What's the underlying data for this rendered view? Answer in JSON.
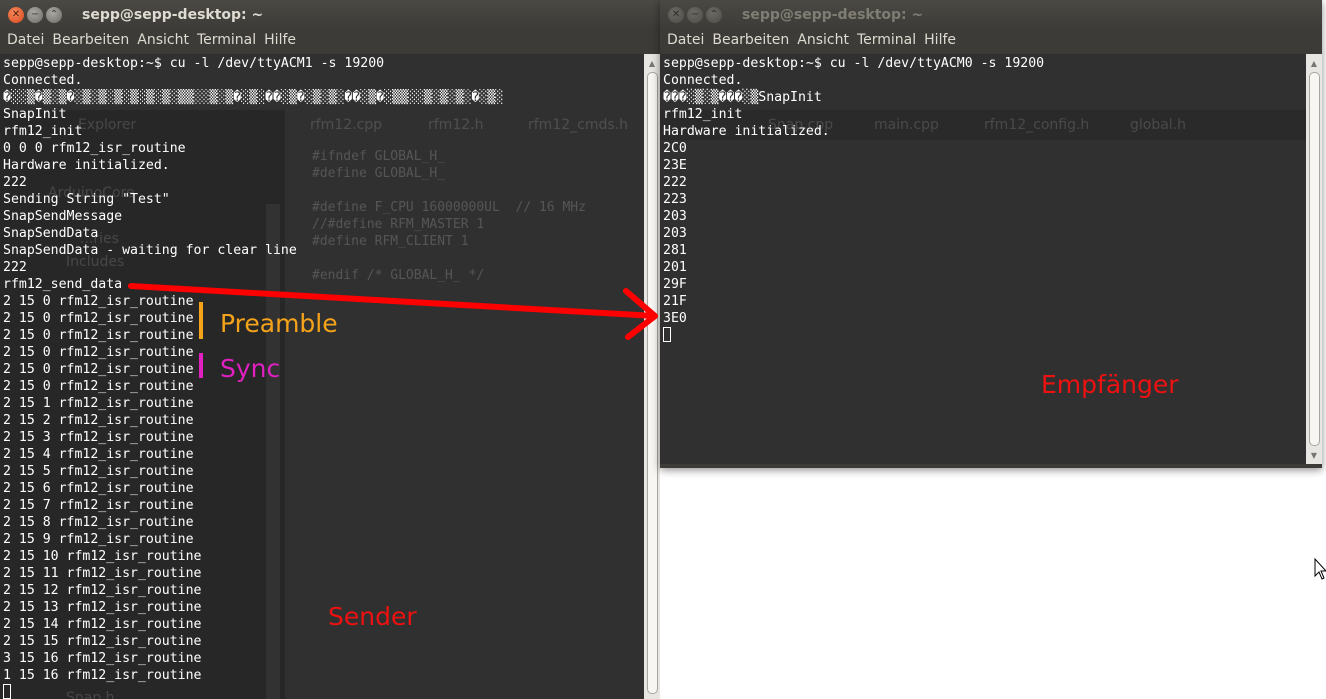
{
  "left_window": {
    "title": "sepp@sepp-desktop: ~",
    "menu": [
      "Datei",
      "Bearbeiten",
      "Ansicht",
      "Terminal",
      "Hilfe"
    ],
    "lines": [
      "sepp@sepp-desktop:~$ cu -l /dev/ttyACM1 -s 19200",
      "Connected.",
      "�░░▒�▒░▒�░▒░▒░▒░▒░▒░▒░▒▒░░▒░▒�░▒░��░▒�░▒░▒░��░▒�░▒▒░░▒░▒░▒░�░▒░",
      "SnapInit",
      "rfm12_init",
      "0 0 0 rfm12_isr_routine",
      "Hardware initialized.",
      "222",
      "Sending String \"Test\"",
      "SnapSendMessage",
      "SnapSendData",
      "SnapSendData - waiting for clear line",
      "222",
      "rfm12_send_data",
      "2 15 0 rfm12_isr_routine",
      "2 15 0 rfm12_isr_routine",
      "2 15 0 rfm12_isr_routine",
      "2 15 0 rfm12_isr_routine",
      "2 15 0 rfm12_isr_routine",
      "2 15 0 rfm12_isr_routine",
      "2 15 1 rfm12_isr_routine",
      "2 15 2 rfm12_isr_routine",
      "2 15 3 rfm12_isr_routine",
      "2 15 4 rfm12_isr_routine",
      "2 15 5 rfm12_isr_routine",
      "2 15 6 rfm12_isr_routine",
      "2 15 7 rfm12_isr_routine",
      "2 15 8 rfm12_isr_routine",
      "2 15 9 rfm12_isr_routine",
      "2 15 10 rfm12_isr_routine",
      "2 15 11 rfm12_isr_routine",
      "2 15 12 rfm12_isr_routine",
      "2 15 13 rfm12_isr_routine",
      "2 15 14 rfm12_isr_routine",
      "2 15 15 rfm12_isr_routine",
      "3 15 16 rfm12_isr_routine",
      "1 15 16 rfm12_isr_routine"
    ]
  },
  "right_window": {
    "title": "sepp@sepp-desktop: ~",
    "menu": [
      "Datei",
      "Bearbeiten",
      "Ansicht",
      "Terminal",
      "Hilfe"
    ],
    "lines": [
      "sepp@sepp-desktop:~$ cu -l /dev/ttyACM0 -s 19200",
      "Connected.",
      "���░▒░▒���░▒SnapInit",
      "rfm12_init",
      "Hardware initialized.",
      "2C0",
      "23E",
      "222",
      "223",
      "203",
      "203",
      "281",
      "201",
      "29F",
      "21F",
      "3E0"
    ]
  },
  "background_ide": {
    "tabs": [
      "rfm12.cpp",
      "rfm12.h",
      "rfm12_cmds.h",
      "Snap.cpp",
      "main.cpp",
      "rfm12_config.h",
      "global.h"
    ],
    "explorer_title": "Explorer",
    "explorer_items": [
      "ArduinoCore",
      "...ries",
      "Includes",
      "Snap.h"
    ],
    "code": [
      "#ifndef GLOBAL_H_",
      "#define GLOBAL_H_",
      "",
      "#define F_CPU 16000000UL  // 16 MHz",
      "//#define RFM_MASTER 1",
      "#define RFM_CLIENT 1",
      "",
      "#endif /* GLOBAL_H_ */"
    ]
  },
  "annotations": {
    "preamble": "Preamble",
    "sync": "Sync",
    "sender": "Sender",
    "receiver": "Empfänger",
    "preamble_color": "#f5a31a",
    "sync_color": "#e020c0",
    "label_red": "#ee1111",
    "arrow_color": "#ff0000"
  }
}
